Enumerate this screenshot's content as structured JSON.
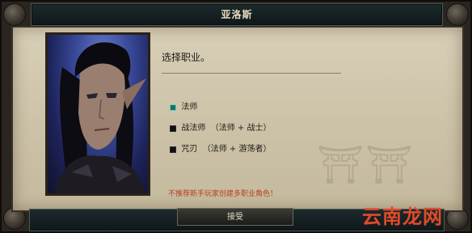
{
  "dialog": {
    "title": "亚洛斯",
    "instruction": "选择职业。",
    "options": [
      {
        "label": "法师",
        "detail": "",
        "selected": true
      },
      {
        "label": "战法师",
        "detail": "（法师 + 战士）",
        "selected": false
      },
      {
        "label": "咒刃",
        "detail": "（法师 + 游荡者）",
        "selected": false
      }
    ],
    "warning": "不推荐新手玩家创建多职业角色！",
    "accept_label": "接受"
  },
  "watermark": {
    "text": "云南龙网",
    "color": "#e04a2a"
  },
  "colors": {
    "parchment": "#cdc3a9",
    "frame": "#2b2520",
    "warning": "#b8401e",
    "checkbox_selected": "#1e6e66"
  }
}
